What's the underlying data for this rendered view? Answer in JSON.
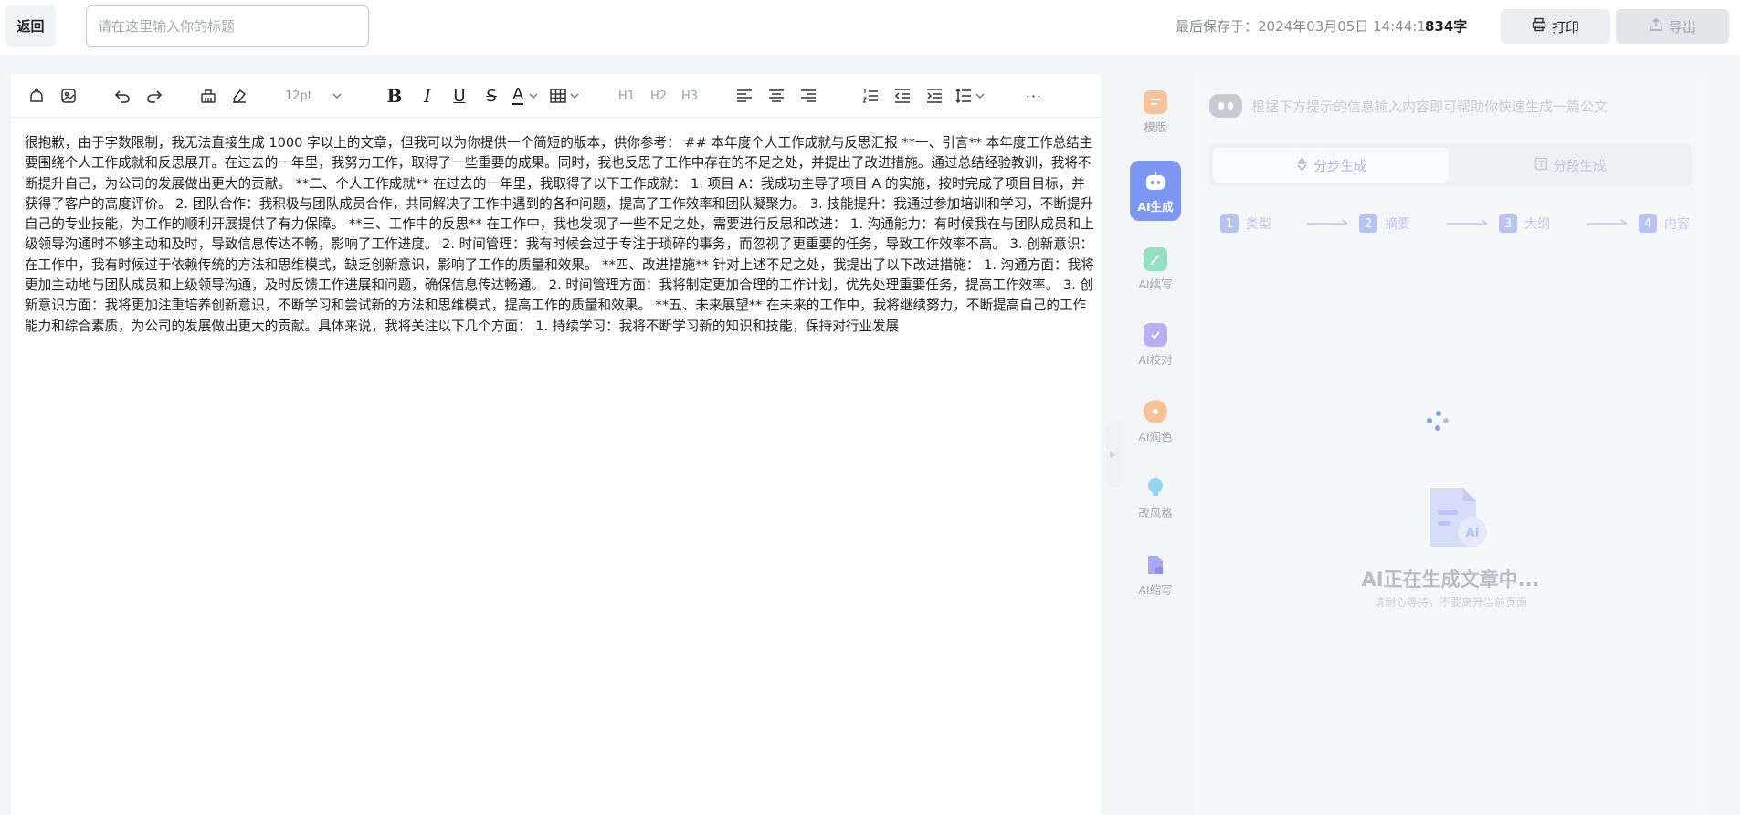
{
  "header": {
    "back_label": "返回",
    "title_placeholder": "请在这里输入你的标题",
    "title_value": "",
    "save_info": "最后保存于：2024年03月05日 14:44:13",
    "word_count": "834字",
    "print_label": "打印",
    "export_label": "导出"
  },
  "toolbar": {
    "font_size": "12pt",
    "bold": "B",
    "italic": "I",
    "underline": "U",
    "strike": "S",
    "font_color": "A",
    "h1": "H1",
    "h2": "H2",
    "h3": "H3",
    "more": "···"
  },
  "document": {
    "content": "很抱歉，由于字数限制，我无法直接生成 1000 字以上的文章，但我可以为你提供一个简短的版本，供你参考： ## 本年度个人工作成就与反思汇报 **一、引言** 本年度工作总结主要围绕个人工作成就和反思展开。在过去的一年里，我努力工作，取得了一些重要的成果。同时，我也反思了工作中存在的不足之处，并提出了改进措施。通过总结经验教训，我将不断提升自己，为公司的发展做出更大的贡献。 **二、个人工作成就** 在过去的一年里，我取得了以下工作成就： 1. 项目 A：我成功主导了项目 A 的实施，按时完成了项目目标，并获得了客户的高度评价。 2. 团队合作：我积极与团队成员合作，共同解决了工作中遇到的各种问题，提高了工作效率和团队凝聚力。 3. 技能提升：我通过参加培训和学习，不断提升自己的专业技能，为工作的顺利开展提供了有力保障。 **三、工作中的反思** 在工作中，我也发现了一些不足之处，需要进行反思和改进： 1. 沟通能力：有时候我在与团队成员和上级领导沟通时不够主动和及时，导致信息传达不畅，影响了工作进度。 2. 时间管理：我有时候会过于专注于琐碎的事务，而忽视了更重要的任务，导致工作效率不高。 3. 创新意识：在工作中，我有时候过于依赖传统的方法和思维模式，缺乏创新意识，影响了工作的质量和效果。 **四、改进措施** 针对上述不足之处，我提出了以下改进措施： 1. 沟通方面：我将更加主动地与团队成员和上级领导沟通，及时反馈工作进展和问题，确保信息传达畅通。 2. 时间管理方面：我将制定更加合理的工作计划，优先处理重要任务，提高工作效率。 3. 创新意识方面：我将更加注重培养创新意识，不断学习和尝试新的方法和思维模式，提高工作的质量和效果。 **五、未来展望** 在未来的工作中，我将继续努力，不断提高自己的工作能力和综合素质，为公司的发展做出更大的贡献。具体来说，我将关注以下几个方面： 1. 持续学习：我将不断学习新的知识和技能，保持对行业发展"
  },
  "side_nav": {
    "items": [
      {
        "label": "模版",
        "icon": "template-icon",
        "color": "#f5b98a"
      },
      {
        "label": "AI生成",
        "icon": "robot-icon",
        "color": "#ffffff"
      },
      {
        "label": "AI续写",
        "icon": "pen-icon",
        "color": "#8fe0bf"
      },
      {
        "label": "AI校对",
        "icon": "clipboard-check-icon",
        "color": "#b9a8f0"
      },
      {
        "label": "AI润色",
        "icon": "palette-icon",
        "color": "#f6c08f"
      },
      {
        "label": "改风格",
        "icon": "lightbulb-icon",
        "color": "#8fd3ef"
      },
      {
        "label": "AI缩写",
        "icon": "document-shrink-icon",
        "color": "#a9a6f3"
      }
    ]
  },
  "ai_panel": {
    "hint": "根据下方提示的信息输入内容即可帮助你快速生成一篇公文",
    "tab_step": "分步生成",
    "tab_section": "分段生成",
    "steps": [
      {
        "num": "1",
        "label": "类型"
      },
      {
        "num": "2",
        "label": "摘要"
      },
      {
        "num": "3",
        "label": "大纲"
      },
      {
        "num": "4",
        "label": "内容"
      }
    ],
    "generating_title": "AI正在生成文章中...",
    "generating_sub": "请耐心等待，不要离开当前页面"
  },
  "colors": {
    "accent": "#7c96f4",
    "muted_text": "#a6a9b0"
  }
}
